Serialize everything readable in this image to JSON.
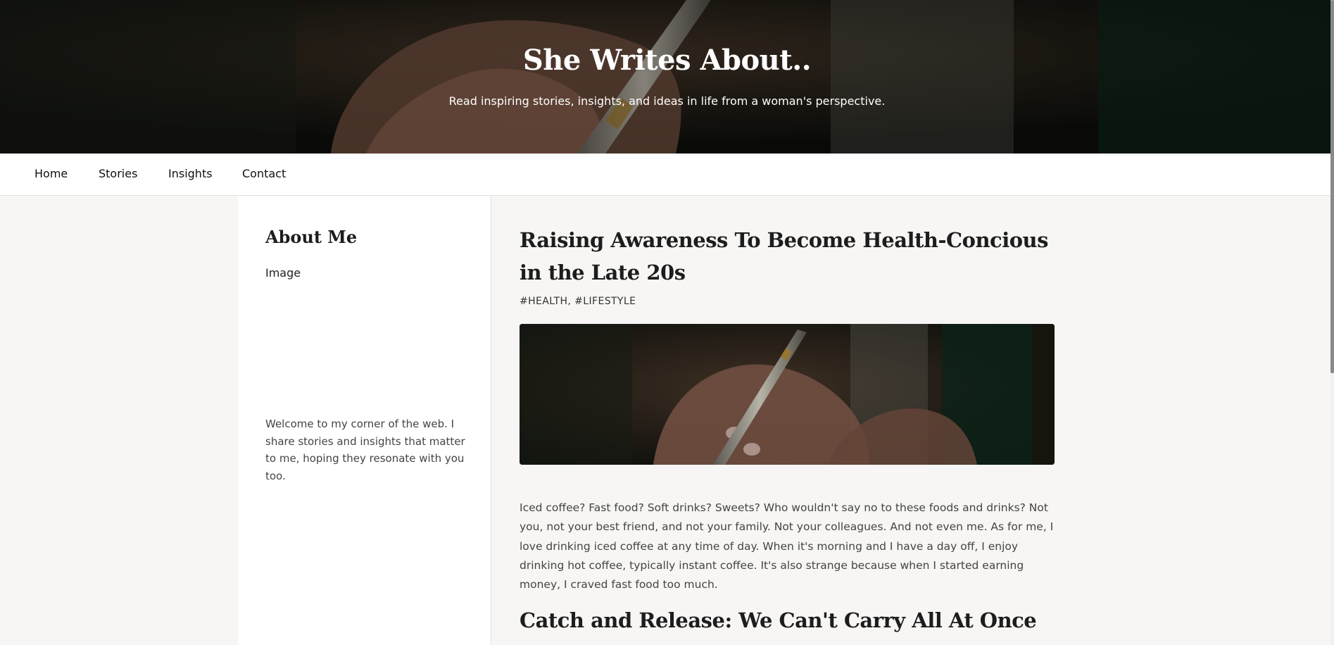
{
  "hero": {
    "title": "She Writes About..",
    "subtitle": "Read inspiring stories, insights, and ideas in life from a woman's perspective."
  },
  "nav": {
    "items": [
      {
        "label": "Home"
      },
      {
        "label": "Stories"
      },
      {
        "label": "Insights"
      },
      {
        "label": "Contact"
      }
    ]
  },
  "sidebar": {
    "title": "About Me",
    "image_placeholder": "Image",
    "text": "Welcome to my corner of the web. I share stories and insights that matter to me, hoping they resonate with you too."
  },
  "posts": [
    {
      "title": "Raising Awareness To Become Health-Concious in the Late 20s",
      "tags": "#HEALTH, #LIFESTYLE",
      "body": "Iced coffee? Fast food? Soft drinks? Sweets? Who wouldn't say no to these foods and drinks? Not you, not your best friend, and not your family. Not your colleagues. And not even me. As for me, I love drinking iced coffee at any time of day. When it's morning and I have a day off, I enjoy drinking hot coffee, typically instant coffee. It's also strange because when I started earning money, I craved fast food too much."
    },
    {
      "title": "Catch and Release: We Can't Carry All At Once"
    }
  ],
  "colors": {
    "page_background": "#f7f6f4",
    "panel_background": "#ffffff",
    "hero_dark": "#0d0f0c",
    "text_dark": "#1d1d1d",
    "text_muted": "#444444"
  }
}
